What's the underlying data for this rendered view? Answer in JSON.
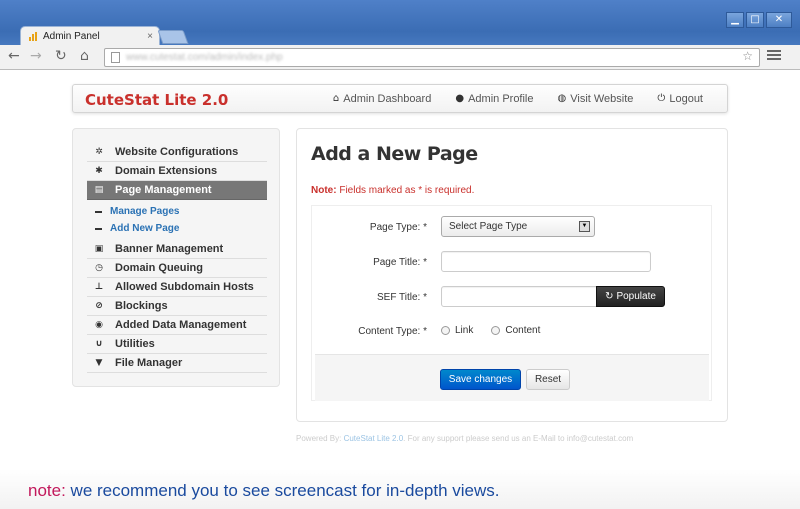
{
  "browser": {
    "tab_title": "Admin Panel",
    "tab_close": "×",
    "url": "www.cutestat.com/admin/index.php",
    "window_controls": [
      "▁",
      "□",
      "✕"
    ],
    "nav_icons": [
      "back-icon",
      "forward-icon",
      "reload-icon",
      "home-icon"
    ]
  },
  "navbar": {
    "brand": "CuteStat Lite 2.0",
    "links": [
      {
        "label": "Admin Dashboard",
        "icon": "home-icon",
        "glyph": "⌂"
      },
      {
        "label": "Admin Profile",
        "icon": "user-icon",
        "glyph": "●"
      },
      {
        "label": "Visit Website",
        "icon": "globe-icon",
        "glyph": "◍"
      },
      {
        "label": "Logout",
        "icon": "power-icon",
        "glyph": "⏻"
      }
    ]
  },
  "sidebar": {
    "items": [
      {
        "label": "Website Configurations",
        "icon": "cog-icon",
        "glyph": "✲"
      },
      {
        "label": "Domain Extensions",
        "icon": "asterisk-icon",
        "glyph": "✱"
      },
      {
        "label": "Page Management",
        "icon": "file-icon",
        "glyph": "▤",
        "active": true
      },
      {
        "label": "Banner Management",
        "icon": "picture-icon",
        "glyph": "▣"
      },
      {
        "label": "Domain Queuing",
        "icon": "clock-icon",
        "glyph": "◷"
      },
      {
        "label": "Allowed Subdomain Hosts",
        "icon": "tasks-icon",
        "glyph": "⊥"
      },
      {
        "label": "Blockings",
        "icon": "ban-icon",
        "glyph": "⊘"
      },
      {
        "label": "Added Data Management",
        "icon": "map-marker-icon",
        "glyph": "◉"
      },
      {
        "label": "Utilities",
        "icon": "magnet-icon",
        "glyph": "∪"
      },
      {
        "label": "File Manager",
        "icon": "filter-icon",
        "glyph": "▼"
      }
    ],
    "subitems": [
      {
        "label": "Manage Pages"
      },
      {
        "label": "Add New Page"
      }
    ]
  },
  "main": {
    "title": "Add a New Page",
    "note_label": "Note:",
    "note_text": " Fields marked as * is required.",
    "form": {
      "page_type_label": "Page Type: *",
      "page_type_value": "Select Page Type",
      "page_title_label": "Page Title: *",
      "page_title_value": "",
      "sef_title_label": "SEF Title: *",
      "sef_title_value": "",
      "populate_label": "Populate",
      "content_type_label": "Content Type: *",
      "content_type_options": [
        "Link",
        "Content"
      ],
      "save_label": "Save changes",
      "reset_label": "Reset"
    }
  },
  "footer": {
    "prefix": "Powered By: ",
    "link": "CuteStat Lite 2.0",
    "suffix": ". For any support please send us an E-Mail to info@cutestat.com"
  },
  "bottom_note": {
    "label": "note:",
    "text": " we recommend you to see screencast for in-depth views."
  },
  "colors": {
    "brand": "#c9302c",
    "primary_button": "#0066cc",
    "active_sidebar": "#777777",
    "link": "#2b72b4",
    "bottom_note_text": "#1a4a9e",
    "bottom_note_label": "#c2185b"
  }
}
